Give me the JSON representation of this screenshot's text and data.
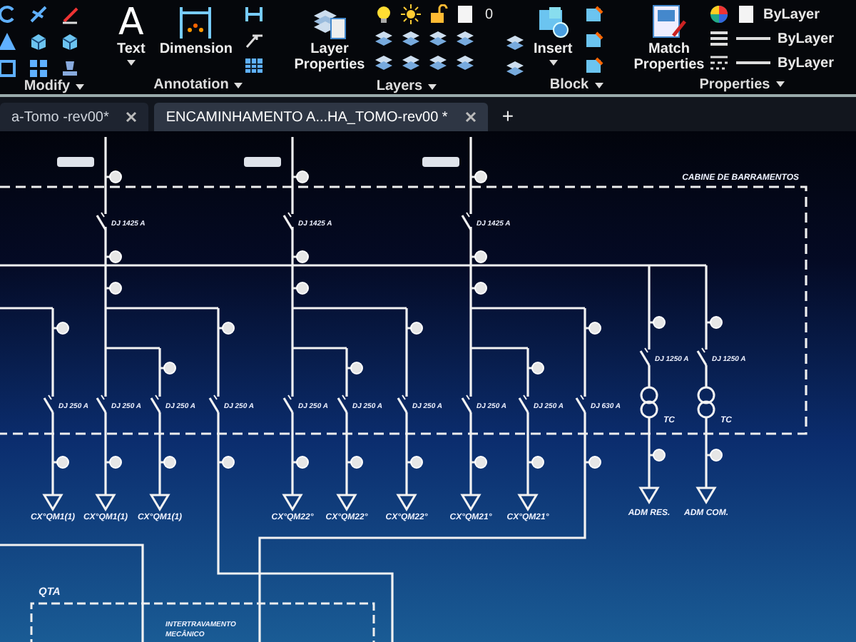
{
  "ribbon": {
    "panels": [
      {
        "kind": "modify",
        "title": "Modify"
      },
      {
        "kind": "annotation",
        "title": "Annotation",
        "buttons": [
          {
            "label": "Text",
            "glyph": "A"
          },
          {
            "label": "Dimension"
          }
        ]
      },
      {
        "kind": "layers",
        "title": "Layers",
        "buttons": [
          {
            "label": "Layer Properties"
          }
        ],
        "layer": "0"
      },
      {
        "kind": "block",
        "title": "Block",
        "buttons": [
          {
            "label": "Insert"
          }
        ]
      },
      {
        "kind": "properties",
        "title": "Properties",
        "buttons": [
          {
            "label": "Match Properties"
          }
        ],
        "values": [
          "ByLayer",
          "ByLayer",
          "ByLayer"
        ]
      }
    ]
  },
  "tabs": [
    {
      "label": "a-Tomo -rev00*",
      "selected": false
    },
    {
      "label": "ENCAMINHAMENTO A...HA_TOMO-rev00 *",
      "selected": true
    }
  ],
  "new_tab": "+",
  "diagram": {
    "enclosure_title": "CABINE DE BARRAMENTOS",
    "feeders": [
      {
        "breaker": "DJ 1425 A",
        "branches": [
          {
            "kind": "outgoing",
            "breaker": "DJ 250 A",
            "load": "CX°QM1(1)"
          },
          {
            "kind": "outgoing",
            "breaker": "DJ 250 A",
            "load": "CX°QM1(1)"
          },
          {
            "kind": "outgoing",
            "breaker": "DJ 250 A",
            "load": "CX°QM1(1)"
          },
          {
            "kind": "transfer",
            "breaker": "DJ 250 A"
          }
        ]
      },
      {
        "breaker": "DJ 1425 A",
        "branches": [
          {
            "kind": "outgoing",
            "breaker": "DJ 250 A",
            "load": "CX°QM22°"
          },
          {
            "kind": "outgoing",
            "breaker": "DJ 250 A",
            "load": "CX°QM22°"
          },
          {
            "kind": "outgoing",
            "breaker": "DJ 250 A",
            "load": "CX°QM22°"
          }
        ]
      },
      {
        "breaker": "DJ 1425 A",
        "branches": [
          {
            "kind": "outgoing",
            "breaker": "DJ 250 A",
            "load": "CX°QM21°"
          },
          {
            "kind": "outgoing",
            "breaker": "DJ 250 A",
            "load": "CX°QM21°"
          },
          {
            "kind": "transfer",
            "breaker": "DJ 630 A"
          }
        ]
      }
    ],
    "ct_feeders": [
      {
        "breaker": "DJ 1250 A",
        "ct": "TC",
        "load": "ADM RES."
      },
      {
        "breaker": "DJ 1250 A",
        "ct": "TC",
        "load": "ADM COM."
      }
    ],
    "qta": {
      "title": "QTA",
      "note_lines": [
        "INTERTRAVAMENTO",
        "MECÂNICO"
      ]
    }
  }
}
